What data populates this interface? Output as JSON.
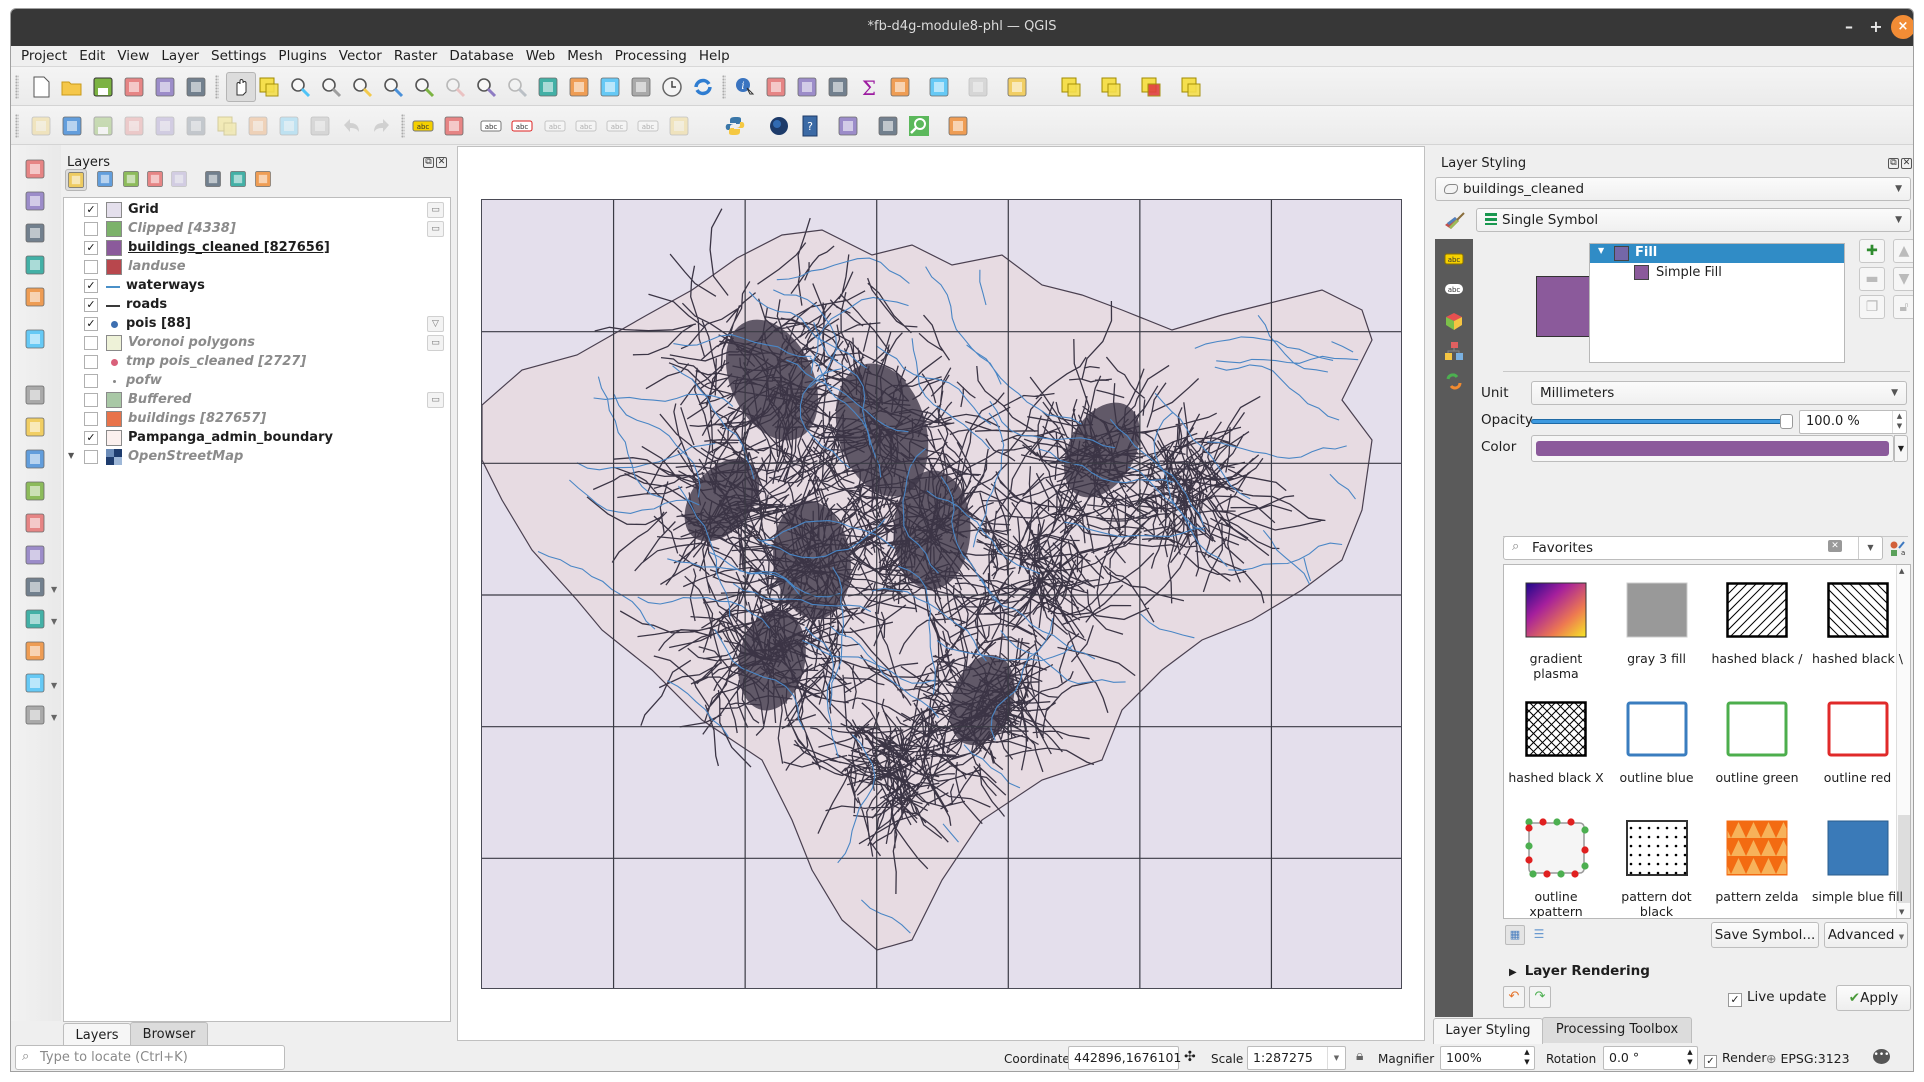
{
  "window": {
    "title": "*fb-d4g-module8-phl — QGIS",
    "controls": {
      "minimize": "–",
      "maximize": "+",
      "close": "×"
    }
  },
  "menu": [
    "Project",
    "Edit",
    "View",
    "Layer",
    "Settings",
    "Plugins",
    "Vector",
    "Raster",
    "Database",
    "Web",
    "Mesh",
    "Processing",
    "Help"
  ],
  "toolbars": {
    "row1_icons": [
      "new-project-icon",
      "open-project-icon",
      "save-project-icon",
      "new-print-layout-icon",
      "layout-manager-icon",
      "style-manager-icon",
      "pan-icon",
      "pan-to-selection-icon",
      "zoom-in-icon",
      "zoom-out-icon",
      "zoom-full-icon",
      "zoom-to-selection-icon",
      "zoom-to-layer-icon",
      "zoom-native-icon",
      "zoom-last-icon",
      "zoom-next-icon",
      "new-map-view-icon",
      "new-3d-map-icon",
      "new-bookmark-icon",
      "show-bookmarks-icon",
      "temporal-controller-icon",
      "refresh-icon",
      "identify-icon",
      "attribute-table-icon",
      "field-calculator-icon",
      "processing-toolbox-icon",
      "statistics-icon",
      "measure-icon",
      "map-tips-icon",
      "run-action-icon",
      "text-annotation-icon",
      "select-features-icon",
      "select-by-value-icon",
      "deselect-icon",
      "select-location-icon"
    ],
    "row2_icons": [
      "current-edits-icon",
      "toggle-editing-icon",
      "save-edits-icon",
      "digitize-icon",
      "vertex-tool-icon",
      "modify-attributes-icon",
      "delete-selected-icon",
      "cut-features-icon",
      "copy-features-icon",
      "paste-features-icon",
      "undo-icon",
      "redo-icon",
      "label-toolbar-icon",
      "diagram-icon",
      "highlight-pinned-labels-icon",
      "pin-labels-icon",
      "show-hide-labels-icon",
      "move-label-icon",
      "rotate-label-icon",
      "change-label-icon",
      "quickosm-icon",
      "python-console-icon",
      "globe-icon",
      "help-icon",
      "topology-checker-icon",
      "qgis-resource-sharing-icon",
      "metasearch-icon",
      "georeferencer-icon"
    ]
  },
  "left_toolbar_icons": [
    "data-source-manager-icon",
    "new-geopackage-layer-icon",
    "new-shapefile-layer-icon",
    "new-spatialite-layer-icon",
    "new-temporary-layer-icon",
    "new-virtual-layer-icon",
    "add-vector-layer-icon",
    "add-raster-layer-icon",
    "add-mesh-layer-icon",
    "add-delimited-text-icon",
    "add-spatialite-layer-icon",
    "add-virtual-layer-icon",
    "add-postgis-layer-icon",
    "add-wms-layer-icon",
    "add-xyz-layer-icon",
    "add-wfs-layer-icon",
    "add-geonode-layer-icon"
  ],
  "layers_panel": {
    "title": "Layers",
    "layers": [
      {
        "name": "Grid",
        "checked": true,
        "symbol": "fill",
        "color": "#e4dfec",
        "visible_style": "bold",
        "indicator": "memory-layer-icon"
      },
      {
        "name": "Clipped [4338]",
        "checked": false,
        "symbol": "fill",
        "color": "#7cb26a",
        "visible_style": "off",
        "indicator": "memory-layer-icon"
      },
      {
        "name": "buildings_cleaned [827656]",
        "checked": true,
        "symbol": "fill",
        "color": "#8b5a9b",
        "visible_style": "selected",
        "indicator": ""
      },
      {
        "name": "landuse",
        "checked": false,
        "symbol": "fill",
        "color": "#b8474d",
        "visible_style": "off",
        "indicator": ""
      },
      {
        "name": "waterways",
        "checked": true,
        "symbol": "line",
        "color": "#4a90c8",
        "visible_style": "bold",
        "indicator": ""
      },
      {
        "name": "roads",
        "checked": true,
        "symbol": "line",
        "color": "#3a3a3a",
        "visible_style": "bold",
        "indicator": ""
      },
      {
        "name": "pois [88]",
        "checked": true,
        "symbol": "point",
        "color": "#3d6fb0",
        "visible_style": "bold",
        "indicator": "filter-icon"
      },
      {
        "name": "Voronoi polygons",
        "checked": false,
        "symbol": "fill",
        "color": "#eef2d8",
        "visible_style": "off",
        "indicator": "memory-layer-icon"
      },
      {
        "name": "tmp pois_cleaned [2727]",
        "checked": false,
        "symbol": "point",
        "color": "#d9607a",
        "visible_style": "off",
        "indicator": ""
      },
      {
        "name": "pofw",
        "checked": false,
        "symbol": "small-point",
        "color": "#888888",
        "visible_style": "off",
        "indicator": ""
      },
      {
        "name": "Buffered",
        "checked": false,
        "symbol": "fill",
        "color": "#a9c8a6",
        "visible_style": "off",
        "indicator": "memory-layer-icon"
      },
      {
        "name": "buildings [827657]",
        "checked": false,
        "symbol": "fill",
        "color": "#e8734a",
        "visible_style": "off",
        "indicator": ""
      },
      {
        "name": "Pampanga_admin_boundary",
        "checked": true,
        "symbol": "fill",
        "color": "#fbf0ee",
        "visible_style": "bold",
        "indicator": ""
      },
      {
        "name": "OpenStreetMap",
        "checked": false,
        "symbol": "raster",
        "color": "#1e3c6e",
        "visible_style": "off",
        "indicator": "",
        "expandable": true
      }
    ],
    "tabs": [
      "Layers",
      "Browser"
    ],
    "active_tab": "Layers"
  },
  "map": {
    "grid": {
      "columns": 7,
      "rows": 6
    },
    "colors": {
      "grid_fill": "#e4dfec",
      "boundary_fill": "#e7dbe2",
      "roads": "#3b3545",
      "waterways": "#4a86c5",
      "grid_line": "#3a3a44"
    }
  },
  "styling_panel": {
    "title": "Layer Styling",
    "layer": "buildings_cleaned",
    "renderer": "Single Symbol",
    "symbol_tree": {
      "root": "Fill",
      "child": "Simple Fill"
    },
    "symbol_color": "#8b5a9b",
    "unit_label": "Unit",
    "unit": "Millimeters",
    "opacity_label": "Opacity",
    "opacity_value": "100.0 %",
    "opacity_fraction": 1.0,
    "color_label": "Color",
    "search_placeholder": "Favorites",
    "gallery": [
      {
        "label": "gradient plasma",
        "style": "gradient"
      },
      {
        "label": "gray 3 fill",
        "style": "gray"
      },
      {
        "label": "hashed black /",
        "style": "hash-fwd"
      },
      {
        "label": "hashed black \\",
        "style": "hash-back"
      },
      {
        "label": "hashed black X",
        "style": "hash-x"
      },
      {
        "label": "outline blue",
        "style": "outline",
        "color": "#3a7dbf"
      },
      {
        "label": "outline green",
        "style": "outline",
        "color": "#4cae4c"
      },
      {
        "label": "outline red",
        "style": "outline",
        "color": "#e02a2a"
      },
      {
        "label": "outline xpattern",
        "style": "xpattern"
      },
      {
        "label": "pattern dot black",
        "style": "dots"
      },
      {
        "label": "pattern zelda",
        "style": "zelda"
      },
      {
        "label": "simple blue fill",
        "style": "solid",
        "color": "#3a7ab8"
      }
    ],
    "save_symbol": "Save Symbol...",
    "advanced": "Advanced",
    "layer_rendering": "Layer Rendering",
    "live_update": "Live update",
    "live_update_checked": true,
    "apply": "Apply",
    "tabs": [
      "Layer Styling",
      "Processing Toolbox"
    ],
    "active_tab": "Layer Styling"
  },
  "statusbar": {
    "locate_placeholder": "Type to locate (Ctrl+K)",
    "coordinate_label": "Coordinate",
    "coordinate": "442896,1676101",
    "scale_label": "Scale",
    "scale": "1:287275",
    "magnifier_label": "Magnifier",
    "magnifier": "100%",
    "rotation_label": "Rotation",
    "rotation": "0.0 °",
    "render_label": "Render",
    "render_checked": true,
    "crs": "EPSG:3123"
  }
}
